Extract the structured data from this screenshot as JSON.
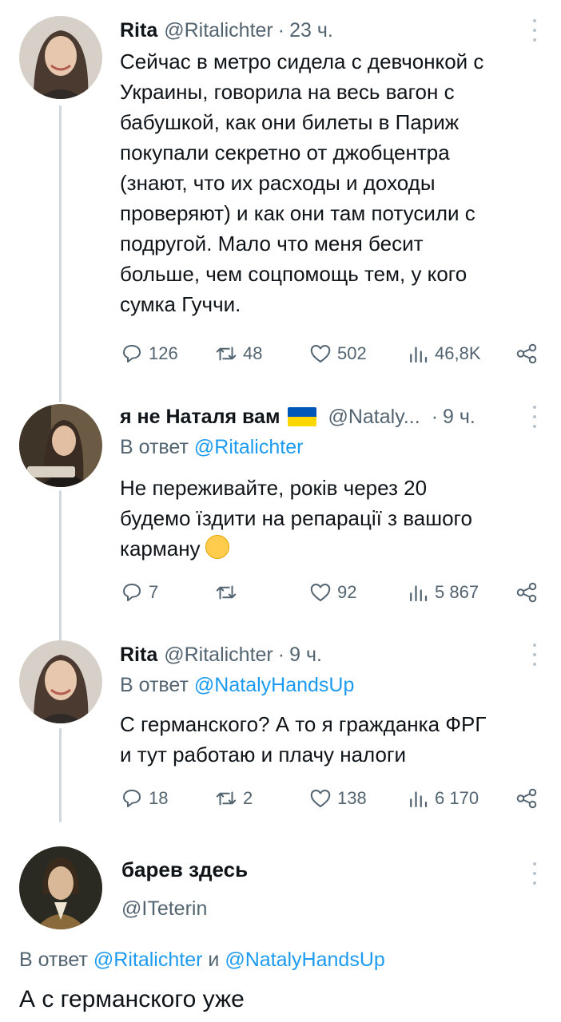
{
  "tweets": [
    {
      "name": "Rita",
      "handle": "@Ritalichter",
      "dot": "·",
      "time": "23 ч.",
      "lines": [
        "Сейчас в метро сидела с девчонкой с",
        "Украины, говорила на весь вагон с",
        "бабушкой, как они билеты в Париж",
        "покупали секретно от джобцентра",
        "(знают, что их расходы и доходы",
        "проверяют) и как они там потусили с",
        "подругой. Мало что меня бесит",
        "больше, чем соцпомощь тем, у кого",
        "сумка Гуччи."
      ],
      "replies": "126",
      "retweets": "48",
      "likes": "502",
      "views": "46,8K"
    },
    {
      "name": "я не Наталя вам",
      "handle": "@Nataly...",
      "dot": "·",
      "time": "9 ч.",
      "reply_prefix": "В ответ",
      "reply_mention": "@Ritalichter",
      "lines": [
        "Не переживайте, років через 20",
        "будемо їздити на репарації з вашого",
        "карману"
      ],
      "replies": "7",
      "retweets": "",
      "likes": "92",
      "views": "5 867"
    },
    {
      "name": "Rita",
      "handle": "@Ritalichter",
      "dot": "·",
      "time": "9 ч.",
      "reply_prefix": "В ответ",
      "reply_mention": "@NatalyHandsUp",
      "lines": [
        "С германского? А то я гражданка ФРГ",
        "и тут работаю и плачу налоги"
      ],
      "replies": "18",
      "retweets": "2",
      "likes": "138",
      "views": "6 170"
    },
    {
      "name": "барев здесь",
      "handle": "@ITeterin",
      "reply_prefix": "В ответ",
      "reply_mention_1": "@Ritalichter",
      "reply_and": "и",
      "reply_mention_2": "@NatalyHandsUp",
      "text": "А с германского уже"
    }
  ],
  "colors": {
    "accent": "#1d9bf0",
    "secondary_text": "#536471",
    "thread_line": "#cfd9de"
  },
  "icons": [
    "reply-icon",
    "retweet-icon",
    "like-icon",
    "views-icon",
    "share-icon",
    "more-icon",
    "ukraine-flag-icon",
    "smiling-face-emoji"
  ]
}
